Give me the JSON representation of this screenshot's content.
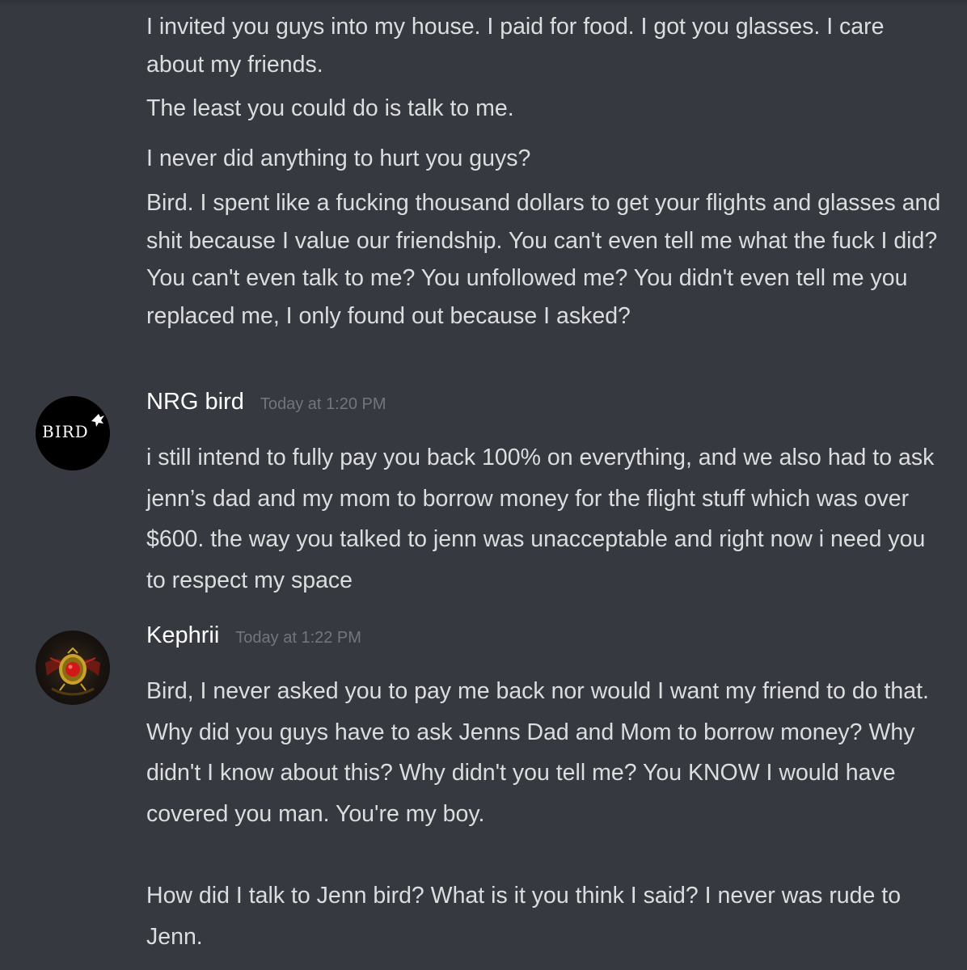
{
  "previous_messages": [
    "I invited you guys into my house. I paid for food. I got you glasses. I care about my friends.",
    "The least you could do is talk to me.",
    "I never did anything to hurt you guys?",
    "Bird. I spent like a fucking thousand dollars to get your flights and glasses and shit because I value our friendship. You can't even tell me what the fuck I did? You can't even talk to me? You unfollowed me? You didn't even tell me you replaced me, I only found out because I asked?"
  ],
  "messages": [
    {
      "username": "NRG bird",
      "timestamp": "Today at 1:20 PM",
      "avatar_text": "BIRD",
      "avatar_icon": "bird-logo-avatar",
      "text": "i still intend to fully pay you back 100% on everything, and we also had to ask jenn’s dad and my mom to borrow money for the flight stuff which was over $600. the way you talked to jenn was unacceptable and right now i need you to respect my space"
    },
    {
      "username": "Kephrii",
      "timestamp": "Today at 1:22 PM",
      "avatar_icon": "scarab-emblem-avatar",
      "text": "Bird, I never asked you to pay me back nor would I want my friend to do that. Why did you guys have to ask Jenns Dad and Mom to borrow money? Why didn't I know about this? Why didn't you tell me? You KNOW I would have covered you man. You're my boy.",
      "text_2": "How did I talk to Jenn bird? What is it you think I said? I never was rude to Jenn."
    }
  ],
  "colors": {
    "background": "#36393f",
    "text": "#dcddde",
    "username": "#ffffff",
    "timestamp": "#72767d"
  }
}
